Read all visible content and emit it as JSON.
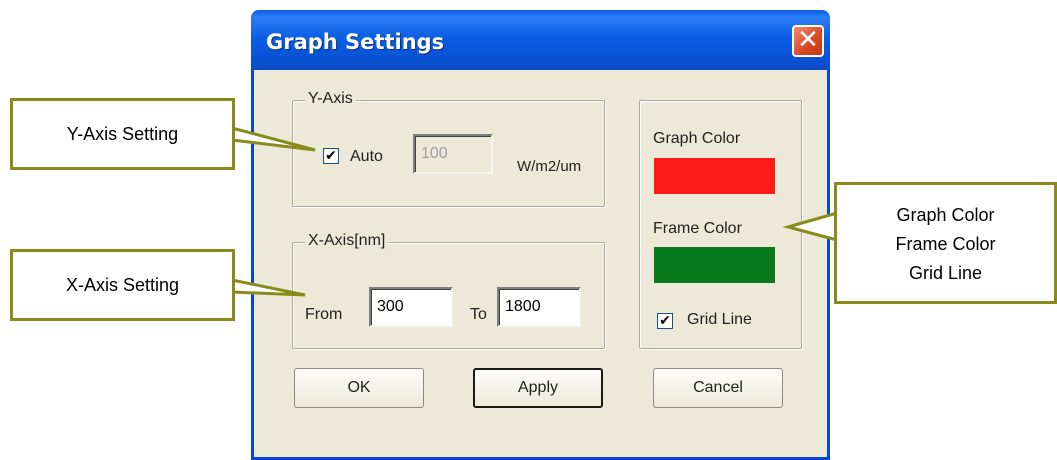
{
  "dialog": {
    "title": "Graph Settings",
    "close_glyph": "✕"
  },
  "y_axis": {
    "legend": "Y-Axis",
    "auto_checked": true,
    "auto_label": "Auto",
    "value": "100",
    "unit": "W/m2/um"
  },
  "x_axis": {
    "legend": "X-Axis[nm]",
    "from_label": "From",
    "from_value": "300",
    "to_label": "To",
    "to_value": "1800"
  },
  "colors": {
    "graph_label": "Graph Color",
    "graph_color": "#ff1a1a",
    "frame_label": "Frame Color",
    "frame_color": "#0a7a1f",
    "grid_checked": true,
    "grid_label": "Grid Line"
  },
  "buttons": {
    "ok": "OK",
    "apply": "Apply",
    "cancel": "Cancel"
  },
  "callouts": {
    "y_axis": "Y-Axis Setting",
    "x_axis": "X-Axis Setting",
    "colors_line1": "Graph Color",
    "colors_line2": "Frame Color",
    "colors_line3": "Grid Line",
    "border_color": "#8a8a1a"
  },
  "icons": {
    "check_glyph": "✔"
  }
}
